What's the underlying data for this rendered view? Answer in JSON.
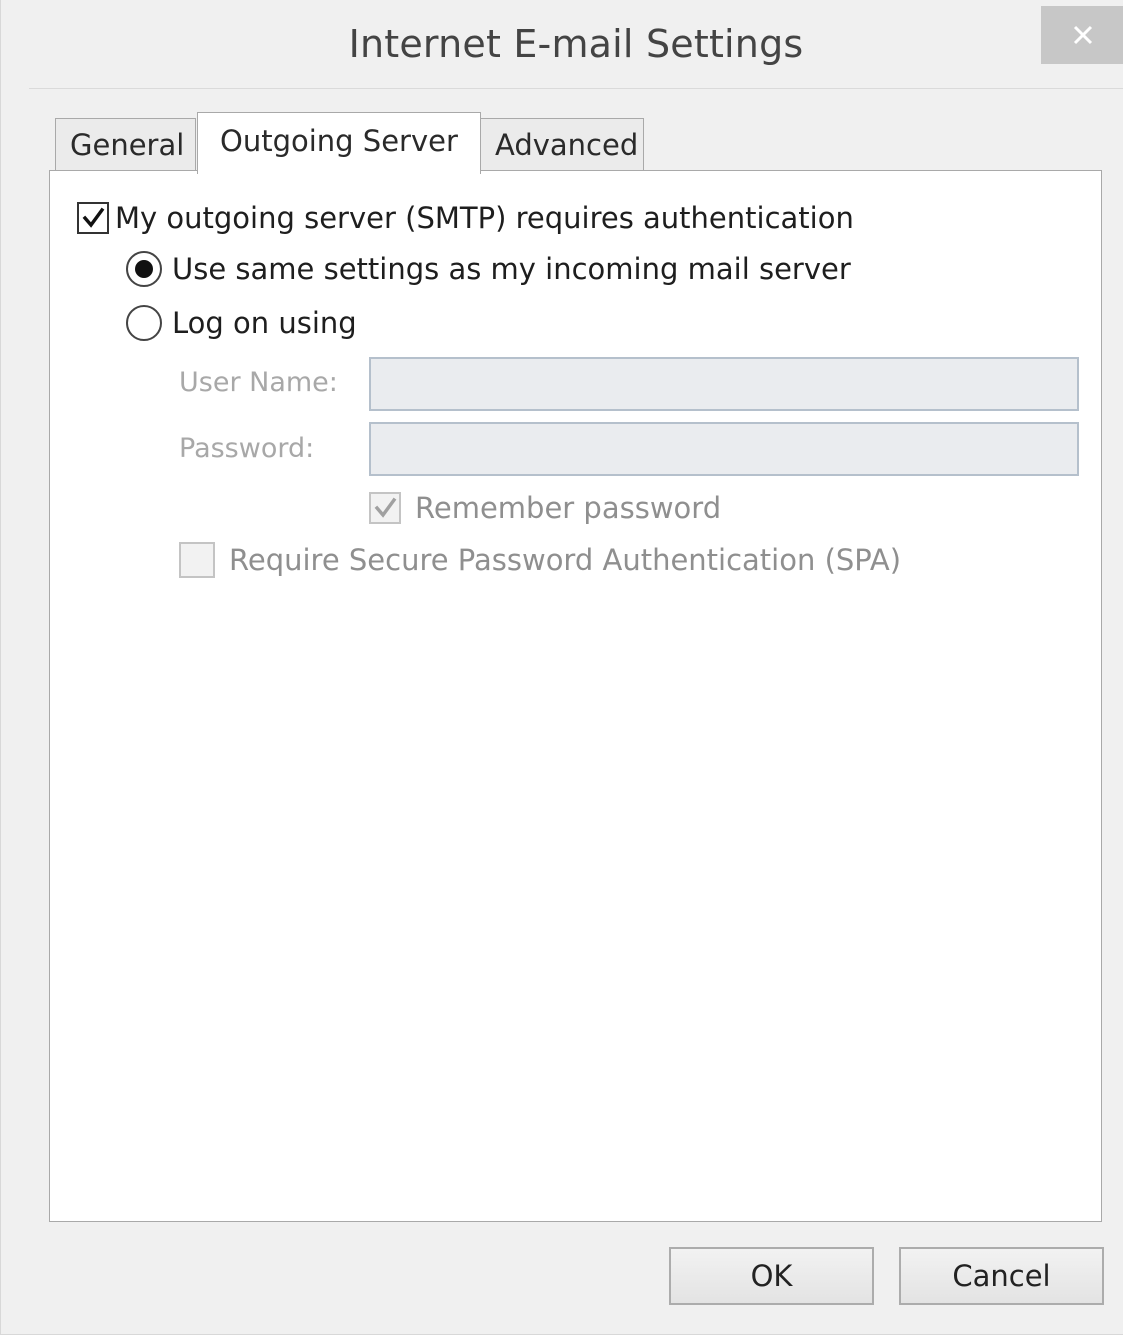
{
  "window": {
    "title": "Internet E-mail Settings",
    "close_glyph": "×"
  },
  "tabs": [
    {
      "label": "General",
      "active": false
    },
    {
      "label": "Outgoing Server",
      "active": true
    },
    {
      "label": "Advanced",
      "active": false
    }
  ],
  "outgoing": {
    "auth_checkbox": {
      "label": "My outgoing server (SMTP) requires authentication",
      "checked": true
    },
    "radio_same": {
      "label": "Use same settings as my incoming mail server",
      "selected": true
    },
    "radio_logon": {
      "label": "Log on using",
      "selected": false
    },
    "username": {
      "label": "User Name:",
      "value": ""
    },
    "password": {
      "label": "Password:",
      "value": ""
    },
    "remember_password": {
      "label": "Remember password",
      "checked": true,
      "enabled": false
    },
    "spa": {
      "label": "Require Secure Password Authentication (SPA)",
      "checked": false,
      "enabled": false
    }
  },
  "buttons": {
    "ok": "OK",
    "cancel": "Cancel"
  },
  "icons": {
    "close": "close-icon",
    "check": "checkmark-icon"
  }
}
